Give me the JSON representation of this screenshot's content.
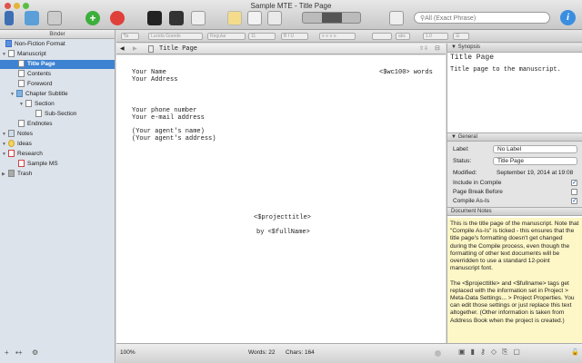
{
  "window": {
    "title": "Sample MTE - Title Page"
  },
  "toolbar": {
    "search_placeholder": "All (Exact Phrase)",
    "info": "i"
  },
  "binder": {
    "header": "Binder",
    "items": [
      {
        "label": "Non-Fiction Format"
      },
      {
        "label": "Manuscript"
      },
      {
        "label": "Title Page"
      },
      {
        "label": "Contents"
      },
      {
        "label": "Foreword"
      },
      {
        "label": "Chapter Subtitle"
      },
      {
        "label": "Section"
      },
      {
        "label": "Sub-Section"
      },
      {
        "label": "Endnotes"
      },
      {
        "label": "Notes"
      },
      {
        "label": "Ideas"
      },
      {
        "label": "Research"
      },
      {
        "label": "Sample MS"
      },
      {
        "label": "Trash"
      }
    ]
  },
  "format_bar": {
    "style": "¶a",
    "font": "Lucida Grande",
    "weight": "Regular",
    "size": "11",
    "line_spacing": "1.0"
  },
  "editor": {
    "doc_title": "Title Page",
    "lines": {
      "name": "Your Name",
      "address": "Your Address",
      "wc": "<$wc100> words",
      "phone": "Your phone number",
      "email": "Your e-mail address",
      "agent": "(Your agent's name)",
      "agent_addr": "(Your agent's address)",
      "project": "<$projecttitle>",
      "by": "by <$fullName>"
    }
  },
  "status": {
    "zoom": "100%",
    "words": "Words: 22",
    "chars": "Chars: 164"
  },
  "inspector": {
    "synopsis_header": "Synopsis",
    "synopsis_title": "Title Page",
    "synopsis_text": "Title page to the manuscript.",
    "general_header": "General",
    "label_label": "Label:",
    "label_value": "No Label",
    "status_label": "Status:",
    "status_value": "Title Page",
    "modified_label": "Modified:",
    "modified_value": "September 19, 2014 at 19:08",
    "include": "Include in Compile",
    "include_checked": true,
    "page_break": "Page Break Before",
    "page_break_checked": false,
    "compile_as_is": "Compile As-Is",
    "compile_as_is_checked": true,
    "notes_header": "Document Notes",
    "notes_p1": "This is the title page of the manuscript. Note that \"Compile As-Is\" is ticked - this ensures that the title page's formatting doesn't get changed during the Compile process, even though the formatting of other text documents will be overridden to use a standard 12-point manuscript font.",
    "notes_p2": "The <$projecttitle> and <$fullname> tags get replaced with the information set in Project > Meta-Data Settings... > Project Properties. You can edit those settings or just replace this text altogether. (Other information is taken from Address Book when the project is created.)"
  }
}
